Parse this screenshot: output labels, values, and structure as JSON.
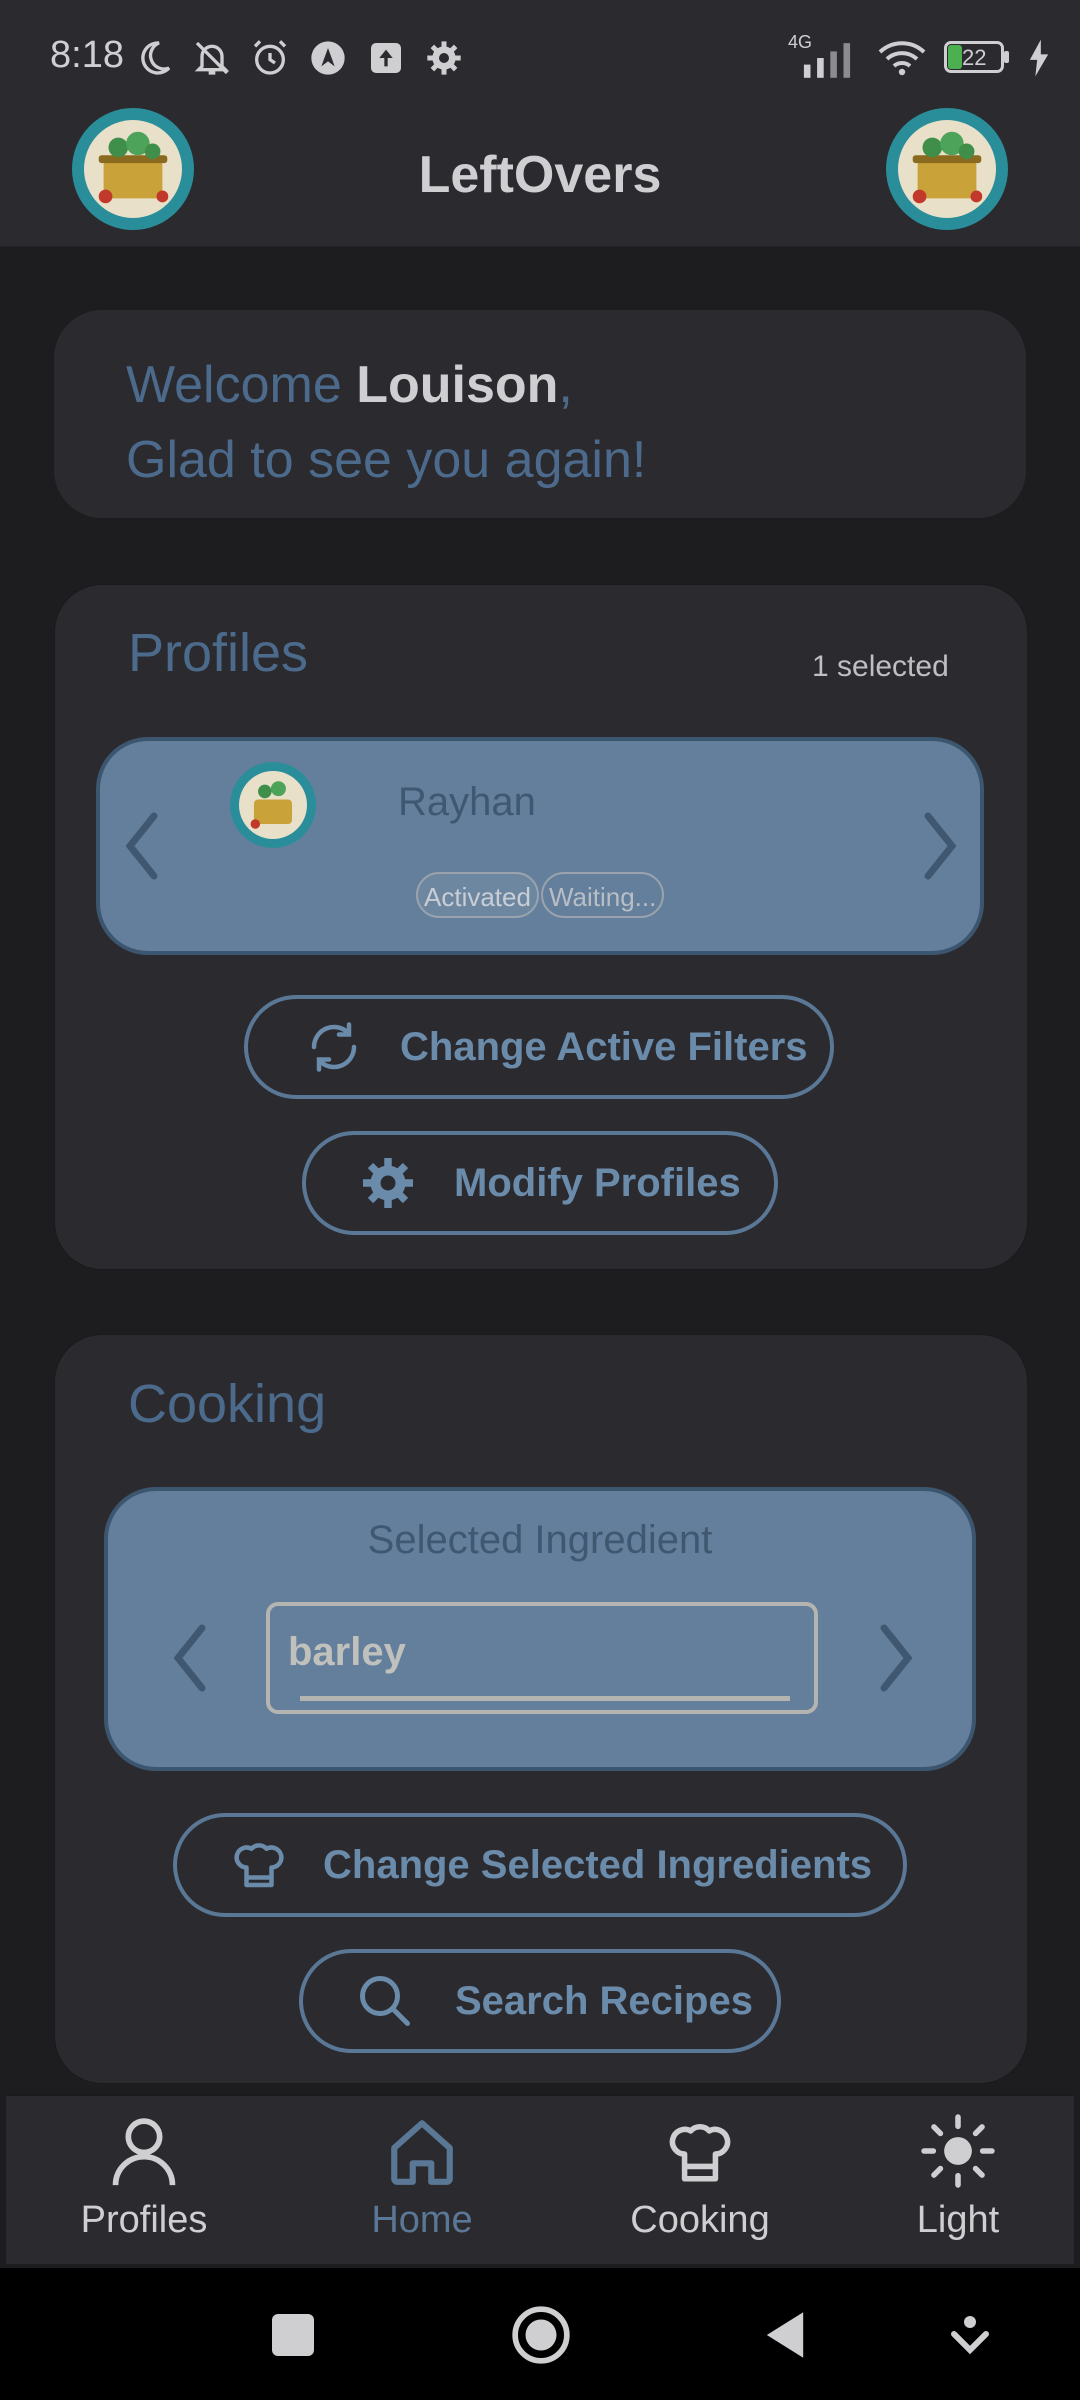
{
  "status_bar": {
    "time": "8:18",
    "network": "4G",
    "battery": "22"
  },
  "app_bar": {
    "title": "LeftOvers"
  },
  "welcome": {
    "greeting": "Welcome ",
    "user_name": "Louison",
    "comma": ",",
    "subtitle": "Glad to see you again!"
  },
  "profiles": {
    "title": "Profiles",
    "selected_count": "1 selected",
    "current_profile": {
      "name": "Rayhan",
      "badges": [
        "Activated",
        "Waiting..."
      ]
    },
    "change_filters_label": "Change Active Filters",
    "modify_profiles_label": "Modify Profiles"
  },
  "cooking": {
    "title": "Cooking",
    "selected_ingredient_label": "Selected Ingredient",
    "ingredient_value": "barley",
    "change_ingredients_label": "Change Selected Ingredients",
    "search_recipes_label": "Search Recipes"
  },
  "bottom_nav": {
    "items": [
      {
        "label": "Profiles",
        "icon": "person-icon"
      },
      {
        "label": "Home",
        "icon": "home-icon",
        "active": true
      },
      {
        "label": "Cooking",
        "icon": "chef-hat-icon"
      },
      {
        "label": "Light",
        "icon": "sun-icon"
      }
    ]
  },
  "colors": {
    "accent": "#5a7896",
    "card": "#2b2a2f",
    "background": "#1d1d20",
    "carousel": "#637f9b"
  }
}
